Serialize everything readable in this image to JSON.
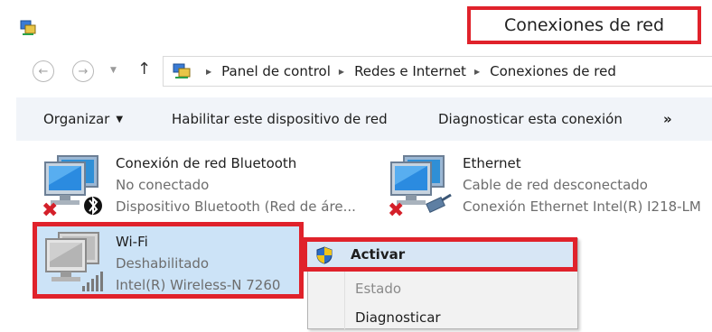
{
  "window": {
    "title": "Conexiones de red",
    "app_icon": "network-connections-icon"
  },
  "navigation": {
    "back_icon": "back-arrow-icon",
    "forward_icon": "forward-arrow-icon",
    "recent_icon": "chevron-down-icon",
    "up_icon": "up-arrow-icon",
    "breadcrumbs": [
      "Panel de control",
      "Redes e Internet",
      "Conexiones de red"
    ]
  },
  "toolbar": {
    "organize_label": "Organizar",
    "enable_label": "Habilitar este dispositivo de red",
    "diagnose_label": "Diagnosticar esta conexión",
    "more_label": "»"
  },
  "connections": [
    {
      "name": "Conexión de red Bluetooth",
      "status": "No conectado",
      "device": "Dispositivo Bluetooth (Red de áre...",
      "icon": "bluetooth-network-icon"
    },
    {
      "name": "Ethernet",
      "status": "Cable de red desconectado",
      "device": "Conexión Ethernet Intel(R) I218-LM",
      "icon": "ethernet-network-icon"
    },
    {
      "name": "Wi-Fi",
      "status": "Deshabilitado",
      "device": "Intel(R) Wireless-N 7260",
      "icon": "wifi-network-icon"
    }
  ],
  "context_menu": {
    "activate_label": "Activar",
    "status_label": "Estado",
    "diagnose_label": "Diagnosticar"
  },
  "colors": {
    "highlight_red": "#e0222b",
    "selection_blue": "#cce3f7",
    "command_bar": "#f1f4f9"
  }
}
